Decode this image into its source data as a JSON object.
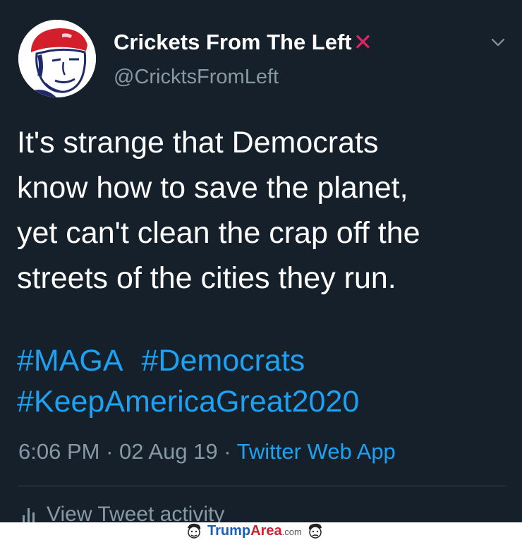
{
  "author": {
    "display_name": "Crickets From The Left",
    "badge_icon": "red-x-icon",
    "badge_glyph": "✕",
    "handle": "@CricktsFromLeft"
  },
  "tweet": {
    "text_lines": [
      "It's strange that Democrats",
      "know how to save the planet,",
      "yet can't clean the crap off the",
      "streets of the cities they run."
    ],
    "hashtags_line1": [
      "#MAGA",
      "#Democrats"
    ],
    "hashtags_line2": [
      "#KeepAmericaGreat2020"
    ]
  },
  "meta": {
    "time": "6:06 PM",
    "sep1": " · ",
    "date": "02 Aug 19",
    "sep2": " · ",
    "source": "Twitter Web App"
  },
  "activity": {
    "label": "View Tweet activity"
  },
  "watermark": {
    "part1": "Trump",
    "part2": "Area",
    "part3": ".com"
  },
  "colors": {
    "background": "#15202b",
    "link": "#1da1f2",
    "secondary": "#8899a6",
    "badge": "#e0245e"
  }
}
